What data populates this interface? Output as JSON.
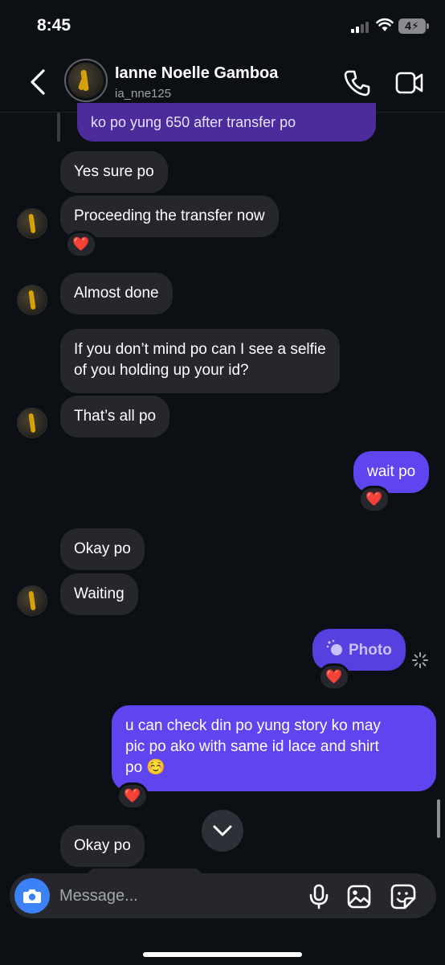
{
  "status_bar": {
    "time": "8:45",
    "battery": "4"
  },
  "header": {
    "name": "Ianne Noelle Gamboa",
    "username": "ia_nne125"
  },
  "messages": {
    "quoted": "ko po yung 650 after transfer po",
    "m1": "Yes sure po",
    "m2": "Proceeding the transfer now",
    "m3": "Almost done",
    "m4_line1": "If you don’t mind po can I see a selfie",
    "m4_line2": "of you holding up your id?",
    "m5": "That’s all po",
    "m6": "wait po",
    "m7": "Okay po",
    "m8": "Waiting",
    "m9": "Photo",
    "m10_line1": "u can check din po yung story ko may",
    "m10_line2": "pic po ako with same id lace and shirt",
    "m10_line3": "po ☺️",
    "m11": "Okay po"
  },
  "reaction": "❤️",
  "composer": {
    "placeholder": "Message..."
  },
  "colors": {
    "outgoing": "#5e45f0",
    "incoming": "#25272c",
    "accent": "#3b82f6",
    "background": "#0c0f14"
  },
  "icons": [
    "back-icon",
    "phone-icon",
    "video-icon",
    "camera-icon",
    "mic-icon",
    "gallery-icon",
    "sticker-icon",
    "chevron-down-icon",
    "heart-icon",
    "loading-icon"
  ]
}
